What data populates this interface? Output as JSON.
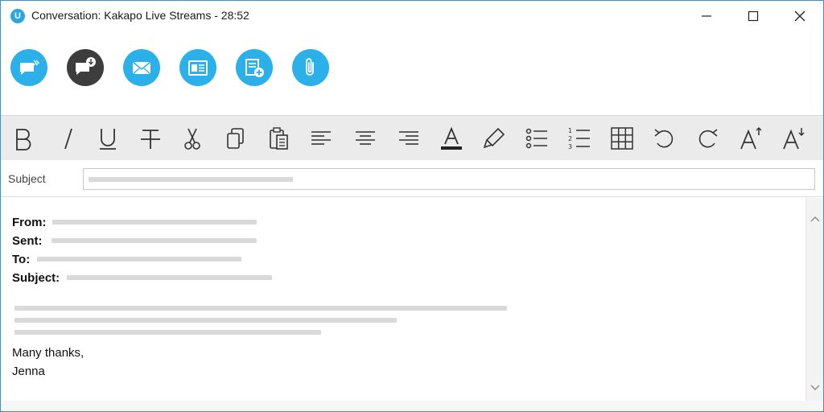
{
  "window": {
    "title": "Conversation: Kakapo Live Streams - 28:52",
    "app_logo_letter": "U"
  },
  "action_bar": {
    "buttons": [
      {
        "icon": "chat-forward-icon",
        "color": "#2bb0ea"
      },
      {
        "icon": "chat-download-icon",
        "color": "#3d3d3d"
      },
      {
        "icon": "email-icon",
        "color": "#2bb0ea"
      },
      {
        "icon": "contact-card-icon",
        "color": "#2bb0ea"
      },
      {
        "icon": "add-note-icon",
        "color": "#2bb0ea"
      },
      {
        "icon": "paperclip-icon",
        "color": "#2bb0ea"
      }
    ]
  },
  "format_toolbar": {
    "buttons": [
      "bold-icon",
      "italic-icon",
      "underline-icon",
      "strikethrough-icon",
      "cut-icon",
      "copy-icon",
      "paste-icon",
      "align-left-icon",
      "align-center-icon",
      "align-right-icon",
      "font-color-icon",
      "highlighter-icon",
      "bulleted-list-icon",
      "numbered-list-icon",
      "table-icon",
      "undo-icon",
      "redo-icon",
      "increase-font-icon",
      "decrease-font-icon"
    ]
  },
  "subject": {
    "label": "Subject"
  },
  "message": {
    "header_from": "From:",
    "header_sent": "Sent:",
    "header_to": "To:",
    "header_subject": "Subject:",
    "closing": "Many thanks,",
    "signature": "Jenna"
  },
  "colors": {
    "accent": "#2bb0ea",
    "dark_button": "#3d3d3d",
    "toolbar_bg": "#ebebeb",
    "window_border": "#3a8fd6"
  }
}
